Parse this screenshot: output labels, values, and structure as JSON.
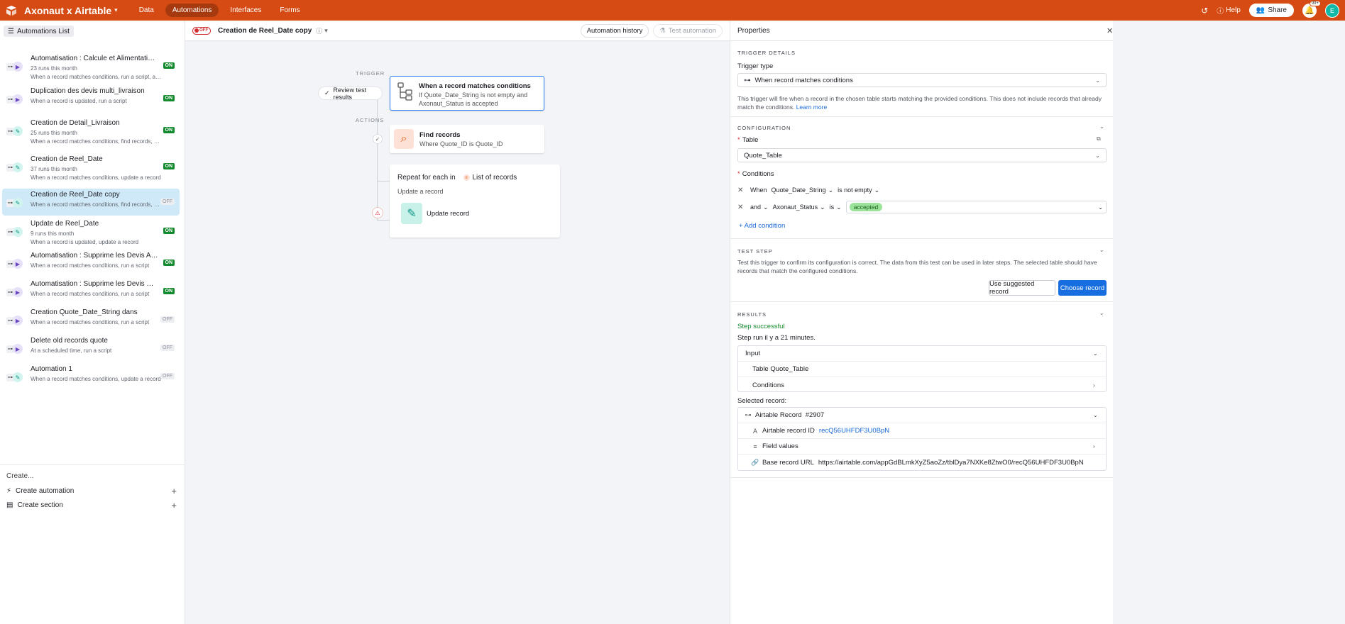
{
  "topbar": {
    "base_name": "Axonaut x Airtable",
    "nav": [
      "Data",
      "Automations",
      "Interfaces",
      "Forms"
    ],
    "active_nav": "Automations",
    "help": "Help",
    "share": "Share",
    "notif_badge": "99+",
    "avatar_initial": "E",
    "brand_color": "#d54b13"
  },
  "sidebar": {
    "list_button": "Automations List",
    "items": [
      {
        "title": "Automatisation : Calcule et Alimentation des t...",
        "sub1": "23 runs this month",
        "sub2": "When a record matches conditions, run a script, and 3 m...",
        "status": "ON",
        "action": "run"
      },
      {
        "title": "Duplication des devis multi_livraison",
        "sub1": "When a record is updated, run a script",
        "sub2": "",
        "status": "ON",
        "action": "run"
      },
      {
        "title": "Creation de Detail_Livraison",
        "sub1": "25 runs this month",
        "sub2": "When a record matches conditions, find records, and 1 ...",
        "status": "ON",
        "action": "upd"
      },
      {
        "title": "Creation de Reel_Date",
        "sub1": "37 runs this month",
        "sub2": "When a record matches conditions, update a record",
        "status": "ON",
        "action": "upd"
      },
      {
        "title": "Creation de Reel_Date copy",
        "sub1": "When a record matches conditions, find records, and 1 ...",
        "sub2": "",
        "status": "OFF",
        "action": "upd"
      },
      {
        "title": "Update de Reel_Date",
        "sub1": "9 runs this month",
        "sub2": "When a record is updated, update a record",
        "status": "ON",
        "action": "upd"
      },
      {
        "title": "Automatisation : Supprime les Devis Accepted...",
        "sub1": "When a record matches conditions, run a script",
        "sub2": "",
        "status": "ON",
        "action": "run"
      },
      {
        "title": "Automatisation : Supprime les Devis Refused",
        "sub1": "When a record matches conditions, run a script",
        "sub2": "",
        "status": "ON",
        "action": "run"
      },
      {
        "title": "Creation Quote_Date_String dans",
        "sub1": "When a record matches conditions, run a script",
        "sub2": "",
        "status": "OFF",
        "action": "run"
      },
      {
        "title": "Delete old records quote",
        "sub1": "At a scheduled time, run a script",
        "sub2": "",
        "status": "OFF",
        "action": "run"
      },
      {
        "title": "Automation 1",
        "sub1": "When a record matches conditions, update a record",
        "sub2": "",
        "status": "OFF",
        "action": "upd"
      }
    ],
    "create_label": "Create...",
    "create_automation": "Create automation",
    "create_section": "Create section"
  },
  "canvas": {
    "toggle_label": "OFF",
    "automation_name": "Creation de Reel_Date copy",
    "history_button": "Automation history",
    "test_button": "Test automation",
    "trigger_label": "TRIGGER",
    "actions_label": "ACTIONS",
    "review_button": "Review test results",
    "trigger_title": "When a record matches conditions",
    "trigger_sub1": "If Quote_Date_String is not empty and",
    "trigger_sub2": "Axonaut_Status is accepted",
    "find_title": "Find records",
    "find_sub": "Where Quote_ID is Quote_ID",
    "repeat_title": "Repeat for each in",
    "repeat_list": "List of records",
    "repeat_sub": "Update a record",
    "update_title": "Update record"
  },
  "panel": {
    "title": "Properties",
    "trigger_details": "TRIGGER DETAILS",
    "trigger_type_label": "Trigger type",
    "trigger_type_value": "When record matches conditions",
    "trigger_desc": "This trigger will fire when a record in the chosen table starts matching the provided conditions. This does not include records that already match the conditions.",
    "learn_more": "Learn more",
    "configuration": "CONFIGURATION",
    "table_label": "Table",
    "table_value": "Quote_Table",
    "conditions_label": "Conditions",
    "cond1": {
      "prefix": "When",
      "field": "Quote_Date_String",
      "op": "is not empty"
    },
    "cond2": {
      "prefix": "and",
      "field": "Axonaut_Status",
      "op": "is",
      "value": "accepted"
    },
    "add_condition": "Add condition",
    "test_step": "TEST STEP",
    "test_desc": "Test this trigger to confirm its configuration is correct. The data from this test can be used in later steps. The selected table should have records that match the configured conditions.",
    "use_suggested": "Use suggested record",
    "choose_record": "Choose record",
    "results": "RESULTS",
    "step_success": "Step successful",
    "step_run": "Step run il y a 21 minutes.",
    "input_label": "Input",
    "table_row_key": "Table",
    "table_row_val": "Quote_Table",
    "conditions_row": "Conditions",
    "selected_record": "Selected record:",
    "record_label": "Airtable Record",
    "record_num": "#2907",
    "record_id_label": "Airtable record ID",
    "record_id_value": "recQ56UHFDF3U0BpN",
    "field_values": "Field values",
    "base_url_label": "Base record URL",
    "base_url_value": "https://airtable.com/appGdBLmkXyZ5aoZz/tblDya7NXKe8ZtwO0/recQ56UHFDF3U0BpN"
  }
}
